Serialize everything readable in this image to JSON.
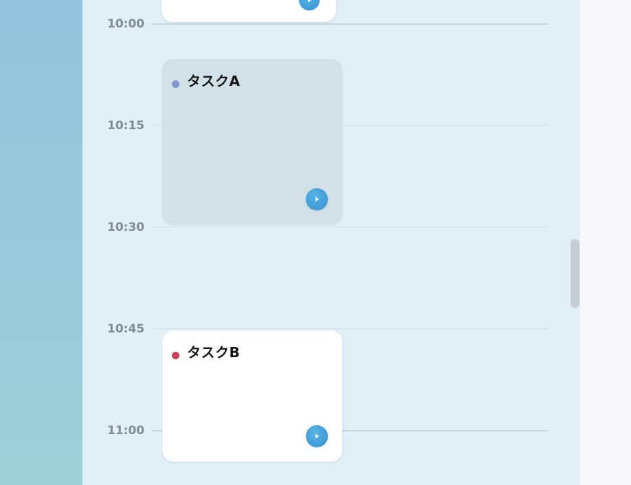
{
  "timeline": {
    "time_labels": [
      "10:00",
      "10:15",
      "10:30",
      "10:45",
      "11:00"
    ]
  },
  "tasks": [
    {
      "title": "タスクA",
      "dot_color": "#8595d0",
      "state": "muted"
    },
    {
      "title": "タスクB",
      "dot_color": "#c8435a",
      "state": "active"
    }
  ],
  "colors": {
    "accent": "#3a9ad9",
    "timeline_bg": "#e1eff8",
    "sidebar_gradient": [
      "#93c3dd",
      "#9ed0d6"
    ]
  },
  "icons": {
    "play": "play-icon"
  }
}
